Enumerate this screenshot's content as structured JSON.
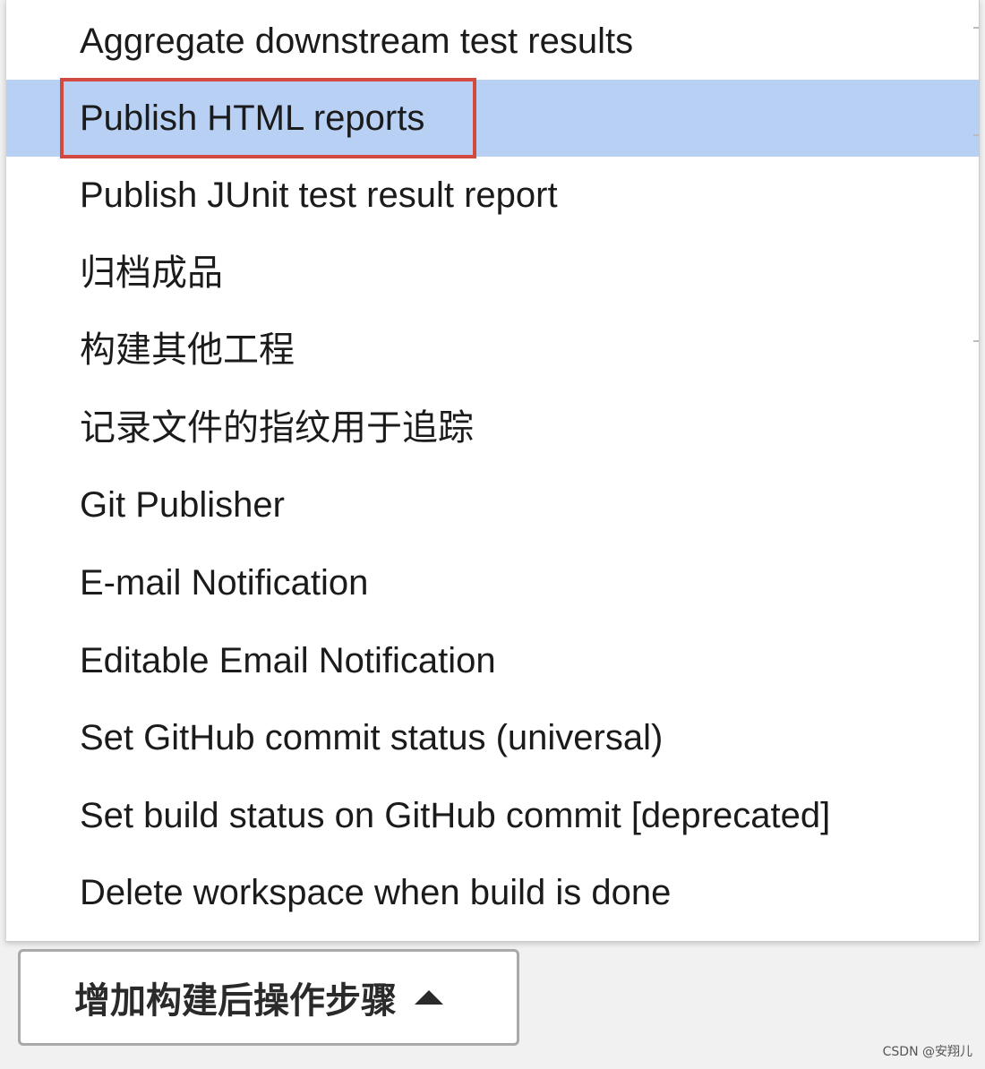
{
  "menu": {
    "items": [
      {
        "label": "Aggregate downstream test results",
        "highlighted": false
      },
      {
        "label": "Publish HTML reports",
        "highlighted": true
      },
      {
        "label": "Publish JUnit test result report",
        "highlighted": false
      },
      {
        "label": "归档成品",
        "highlighted": false
      },
      {
        "label": "构建其他工程",
        "highlighted": false
      },
      {
        "label": "记录文件的指纹用于追踪",
        "highlighted": false
      },
      {
        "label": "Git Publisher",
        "highlighted": false
      },
      {
        "label": "E-mail Notification",
        "highlighted": false
      },
      {
        "label": "Editable Email Notification",
        "highlighted": false
      },
      {
        "label": "Set GitHub commit status (universal)",
        "highlighted": false
      },
      {
        "label": "Set build status on GitHub commit [deprecated]",
        "highlighted": false
      },
      {
        "label": "Delete workspace when build is done",
        "highlighted": false
      }
    ]
  },
  "add_post_build_button": {
    "label": "增加构建后操作步骤",
    "icon": "caret-up-icon"
  },
  "watermark": "CSDN @安翔儿",
  "colors": {
    "highlight": "#b7d0f3",
    "annotation_box": "#d24a3e"
  }
}
